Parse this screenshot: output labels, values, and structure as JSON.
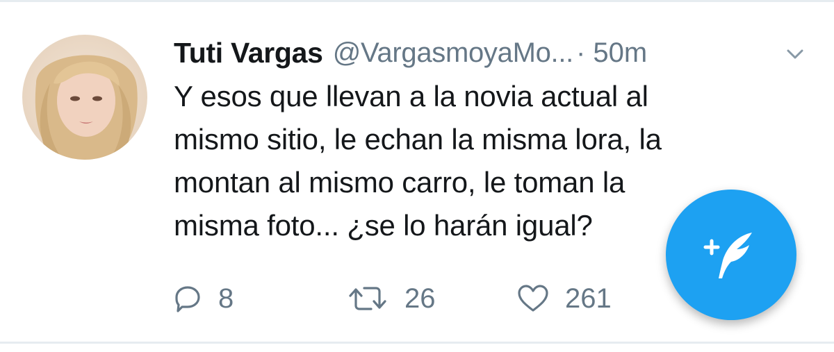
{
  "tweet": {
    "author_name": "Tuti Vargas",
    "handle": "@VargasmoyaMo...",
    "time": "· 50m",
    "text": "Y esos que llevan a la novia actual al\nmismo sitio, le echan la misma lora, la\nmontan al mismo carro, le toman la\nmisma foto... ¿se lo harán igual?",
    "replies": "8",
    "retweets": "26",
    "likes": "261"
  },
  "icons": {
    "avatar": "avatar-photo",
    "menu": "chevron-down-icon",
    "reply": "reply-icon",
    "retweet": "retweet-icon",
    "like": "heart-icon",
    "compose": "compose-tweet-icon"
  },
  "colors": {
    "accent": "#1da1f2",
    "text": "#14171a",
    "secondary": "#657786",
    "divider": "#e6ecf0"
  }
}
